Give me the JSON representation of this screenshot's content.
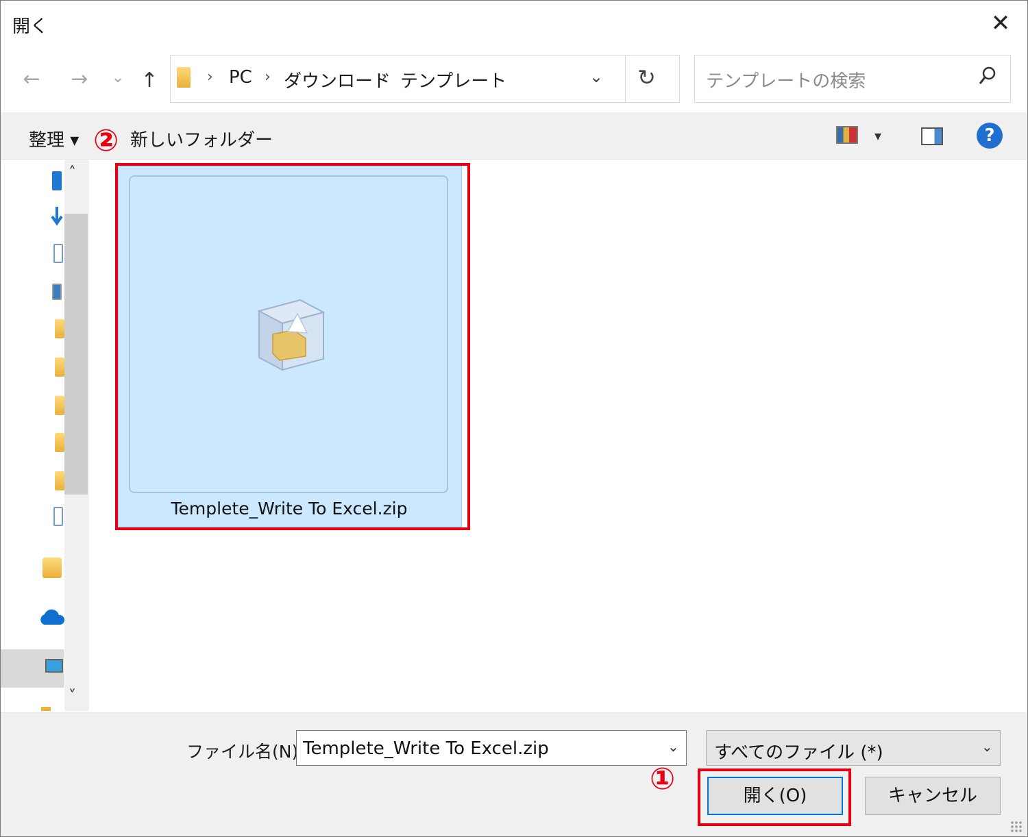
{
  "window": {
    "title": "開く",
    "close": "✕"
  },
  "nav": {
    "back": "←",
    "forward": "→",
    "recent": "⌄",
    "up": "↑",
    "refresh": "↻"
  },
  "address": {
    "crumbs": [
      "PC",
      "ダウンロード",
      "テンプレート"
    ],
    "sep": "›",
    "dropdown": "⌄"
  },
  "search": {
    "placeholder": "テンプレートの検索"
  },
  "toolbar": {
    "organize": "整理 ▾",
    "new_folder": "新しいフォルダー",
    "view_drop": "▾",
    "help": "?"
  },
  "content": {
    "files": [
      {
        "name": "Templete_Write To Excel.zip",
        "selected": true
      }
    ]
  },
  "annotations": {
    "one": "①",
    "two": "②",
    "color": "#e60012"
  },
  "footer": {
    "filename_label": "ファイル名(N):",
    "filename_value": "Templete_Write To Excel.zip",
    "filetype_value": "すべてのファイル (*)",
    "open_label": "開く(O)",
    "cancel_label": "キャンセル"
  },
  "scroll": {
    "up": "˄",
    "down": "˅"
  },
  "colors": {
    "accent": "#0078d7",
    "selection": "#cce8ff",
    "highlight": "#e60012"
  }
}
